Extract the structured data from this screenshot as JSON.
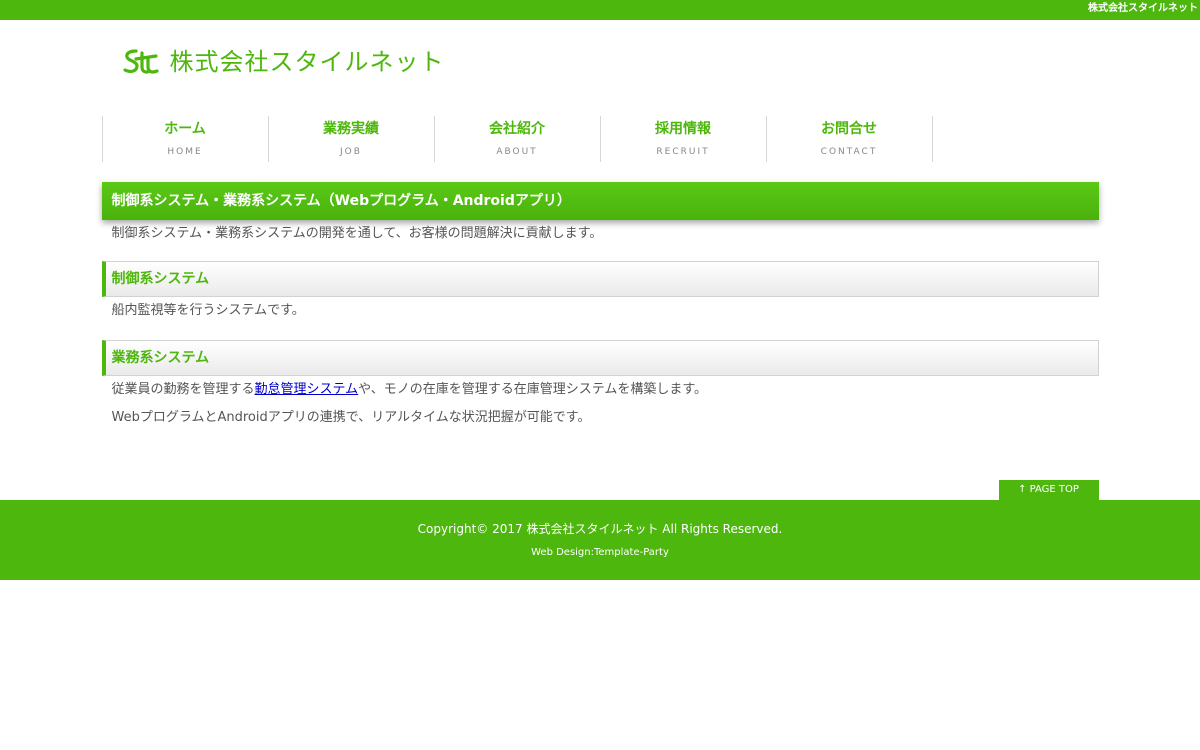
{
  "topbar": {
    "text": "株式会社スタイルネット"
  },
  "header": {
    "logo_icon": "st-logo-icon",
    "company_name": "株式会社スタイルネット"
  },
  "nav": {
    "items": [
      {
        "label": "ホーム",
        "sub": "HOME"
      },
      {
        "label": "業務実績",
        "sub": "JOB"
      },
      {
        "label": "会社紹介",
        "sub": "ABOUT"
      },
      {
        "label": "採用情報",
        "sub": "RECRUIT"
      },
      {
        "label": "お問合せ",
        "sub": "CONTACT"
      }
    ]
  },
  "main": {
    "title": "制御系システム・業務系システム（Webプログラム・Androidアプリ）",
    "intro": "制御系システム・業務系システムの開発を通して、お客様の問題解決に貢献します。",
    "section1": {
      "heading": "制御系システム",
      "text": "船内監視等を行うシステムです。"
    },
    "section2": {
      "heading": "業務系システム",
      "line1_before": "従業員の勤務を管理する",
      "line1_link": "勤怠管理システム",
      "line1_after": "や、モノの在庫を管理する在庫管理システムを構築します。",
      "line2": "WebプログラムとAndroidアプリの連携で、リアルタイムな状況把握が可能です。"
    }
  },
  "pagetop": {
    "label": "↑ PAGE TOP"
  },
  "footer": {
    "copyright": "Copyright© 2017 株式会社スタイルネット All Rights Reserved.",
    "design": "Web Design:Template-Party"
  },
  "colors": {
    "brand_green": "#4db70d",
    "link_blue": "#0000cc"
  }
}
